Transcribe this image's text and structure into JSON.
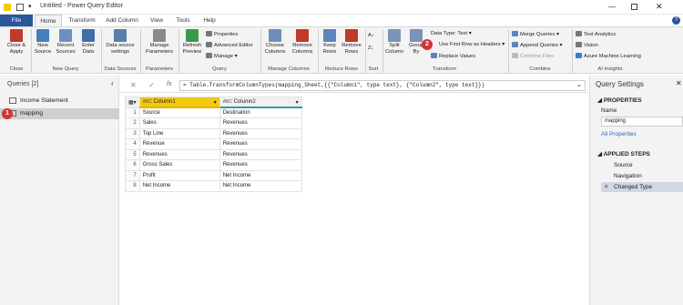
{
  "window": {
    "title": "Untitled - Power Query Editor"
  },
  "tabs": [
    "File",
    "Home",
    "Transform",
    "Add Column",
    "View",
    "Tools",
    "Help"
  ],
  "ribbon": {
    "close": {
      "label1": "Close &",
      "label2": "Apply",
      "group": "Close"
    },
    "new_source": {
      "label1": "New",
      "label2": "Source"
    },
    "recent_sources": {
      "label1": "Recent",
      "label2": "Sources"
    },
    "enter_data": {
      "label1": "Enter",
      "label2": "Data"
    },
    "new_query_group": "New Query",
    "data_source_settings": {
      "label1": "Data source",
      "label2": "settings"
    },
    "data_sources_group": "Data Sources",
    "manage_parameters": {
      "label1": "Manage",
      "label2": "Parameters"
    },
    "parameters_group": "Parameters",
    "refresh_preview": {
      "label1": "Refresh",
      "label2": "Preview"
    },
    "properties": "Properties",
    "advanced_editor": "Advanced Editor",
    "manage": "Manage",
    "query_group": "Query",
    "choose_columns": {
      "label1": "Choose",
      "label2": "Columns"
    },
    "remove_columns": {
      "label1": "Remove",
      "label2": "Columns"
    },
    "manage_columns_group": "Manage Columns",
    "keep_rows": {
      "label1": "Keep",
      "label2": "Rows"
    },
    "remove_rows": {
      "label1": "Remove",
      "label2": "Rows"
    },
    "reduce_rows_group": "Reduce Rows",
    "sort_group": "Sort",
    "split_column": {
      "label1": "Split",
      "label2": "Column"
    },
    "group_by": {
      "label1": "Group",
      "label2": "By"
    },
    "data_type": "Data Type: Text",
    "use_first_row": "Use First Row as Headers",
    "replace_values": "Replace Values",
    "transform_group": "Transform",
    "merge_queries": "Merge Queries",
    "append_queries": "Append Queries",
    "combine_files": "Combine Files",
    "combine_group": "Combine",
    "text_analytics": "Text Analytics",
    "vision": "Vision",
    "azure_ml": "Azure Machine Learning",
    "ai_group": "AI Insights"
  },
  "queries": {
    "header": "Queries [2]",
    "items": [
      "Income Statement",
      "mapping"
    ]
  },
  "formula": "= Table.TransformColumnTypes(mapping_Sheet,{{\"Column1\", type text}, {\"Column2\", type text}})",
  "grid": {
    "headers": [
      "Column1",
      "Column2"
    ],
    "rows": [
      [
        "1",
        "Source",
        "Destination"
      ],
      [
        "2",
        "Sales",
        "Revenues"
      ],
      [
        "3",
        "Top Line",
        "Revenues"
      ],
      [
        "4",
        "Revenue",
        "Revenues"
      ],
      [
        "5",
        "Revenues",
        "Revenues"
      ],
      [
        "6",
        "Gross Sales",
        "Revenues"
      ],
      [
        "7",
        "Profit",
        "Net Income"
      ],
      [
        "8",
        "Net Income",
        "Net Income"
      ]
    ]
  },
  "settings": {
    "title": "Query Settings",
    "properties": "PROPERTIES",
    "name_label": "Name",
    "name_value": "mapping",
    "all_properties": "All Properties",
    "applied_steps": "APPLIED STEPS",
    "steps": [
      "Source",
      "Navigation",
      "Changed Type"
    ]
  },
  "badges": [
    "1",
    "2"
  ]
}
